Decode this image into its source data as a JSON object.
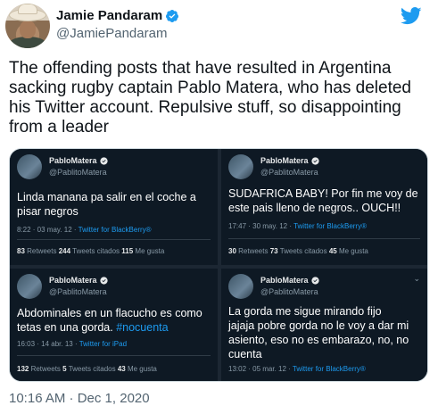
{
  "author": {
    "display_name": "Jamie Pandaram",
    "handle": "@JamiePandaram"
  },
  "tweet_text": "The offending posts that have resulted in Argentina sacking rugby captain Pablo Matera, who has deleted his Twitter account. Repulsive stuff, so disappointing from a leader",
  "timestamp": "10:16 AM · Dec 1, 2020",
  "embedded_posts": [
    {
      "name": "PabloMatera",
      "handle": "@PablitoMatera",
      "line1": "Linda manana pa salir en el coche a",
      "line2": "pisar negros",
      "line3": "",
      "line4": "",
      "date": "8:22 · 03 may. 12 · ",
      "source": "Twitter for BlackBerry®",
      "retweets": "83",
      "retweets_label": " Retweets  ",
      "quotes": "244",
      "quotes_label": " Tweets citados  ",
      "likes": "115",
      "likes_label": " Me gusta"
    },
    {
      "name": "PabloMatera",
      "handle": "@PablitoMatera",
      "line1": "SUDAFRICA BABY! Por fin me voy de",
      "line2": "este pais lleno de negros..  OUCH!!",
      "line3": "",
      "line4": "",
      "date": "17:47 · 30 may. 12 · ",
      "source": "Twitter for BlackBerry®",
      "retweets": "30",
      "retweets_label": " Retweets  ",
      "quotes": "73",
      "quotes_label": " Tweets citados  ",
      "likes": "45",
      "likes_label": " Me gusta"
    },
    {
      "name": "PabloMatera",
      "handle": "@PablitoMatera",
      "line1": "Abdominales en un flacucho es como",
      "line2": "tetas en una gorda. ",
      "hashtag": "#nocuenta",
      "line3": "",
      "line4": "",
      "date": "16:03 · 14 abr. 13 · ",
      "source": "Twitter for iPad",
      "retweets": "132",
      "retweets_label": " Retweets  ",
      "quotes": "5",
      "quotes_label": " Tweets citados  ",
      "likes": "43",
      "likes_label": " Me gusta"
    },
    {
      "name": "PabloMatera",
      "handle": "@PablitoMatera",
      "line1": "La gorda me sigue mirando fijo",
      "line2": "jajaja pobre gorda no le voy a dar mi",
      "line3": "asiento, eso no es embarazo, no, no",
      "line4": "cuenta",
      "date": "13:02 · 05 mar. 12 · ",
      "source": "Twitter for BlackBerry®",
      "retweets": "",
      "retweets_label": "",
      "quotes": "",
      "quotes_label": "",
      "likes": "",
      "likes_label": ""
    }
  ],
  "colors": {
    "twitter_blue": "#1d9bf0",
    "text_primary": "#0f1419",
    "text_secondary": "#536471",
    "card_background": "#0e1924"
  },
  "icons": [
    "verified-badge-icon",
    "twitter-bird-icon",
    "chevron-down-icon"
  ]
}
